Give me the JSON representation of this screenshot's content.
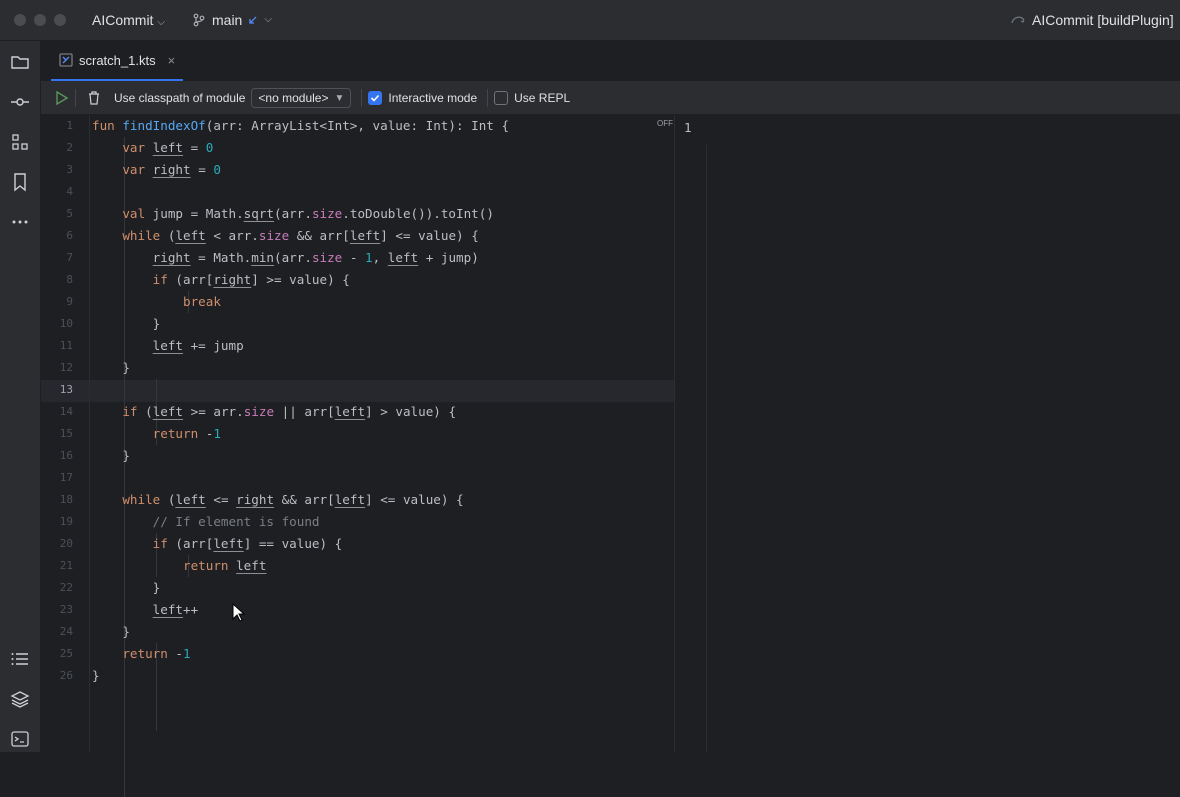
{
  "titlebar": {
    "project": "AICommit",
    "branch": "main",
    "run_config": "AICommit [buildPlugin]"
  },
  "sidebar": {
    "icons": [
      "folder-icon",
      "commit-icon",
      "structure-icon",
      "bookmark-icon",
      "more-icon",
      "todo-icon",
      "layers-icon",
      "terminal-icon"
    ]
  },
  "tab": {
    "label": "scratch_1.kts",
    "close": "×"
  },
  "toolbar": {
    "classpath_label": "Use classpath of module",
    "module_value": "<no module>",
    "interactive_label": "Interactive mode",
    "interactive_checked": true,
    "repl_label": "Use REPL",
    "repl_checked": false
  },
  "editor": {
    "off_badge": "OFF",
    "current_line": 13,
    "line_numbers": [
      "1",
      "2",
      "3",
      "4",
      "5",
      "6",
      "7",
      "8",
      "9",
      "10",
      "11",
      "12",
      "13",
      "14",
      "15",
      "16",
      "17",
      "18",
      "19",
      "20",
      "21",
      "22",
      "23",
      "24",
      "25",
      "26"
    ]
  },
  "output": {
    "lines": [
      "1"
    ]
  },
  "colors": {
    "accent": "#3574f0",
    "background": "#1e1f22",
    "panel": "#2b2d30"
  }
}
